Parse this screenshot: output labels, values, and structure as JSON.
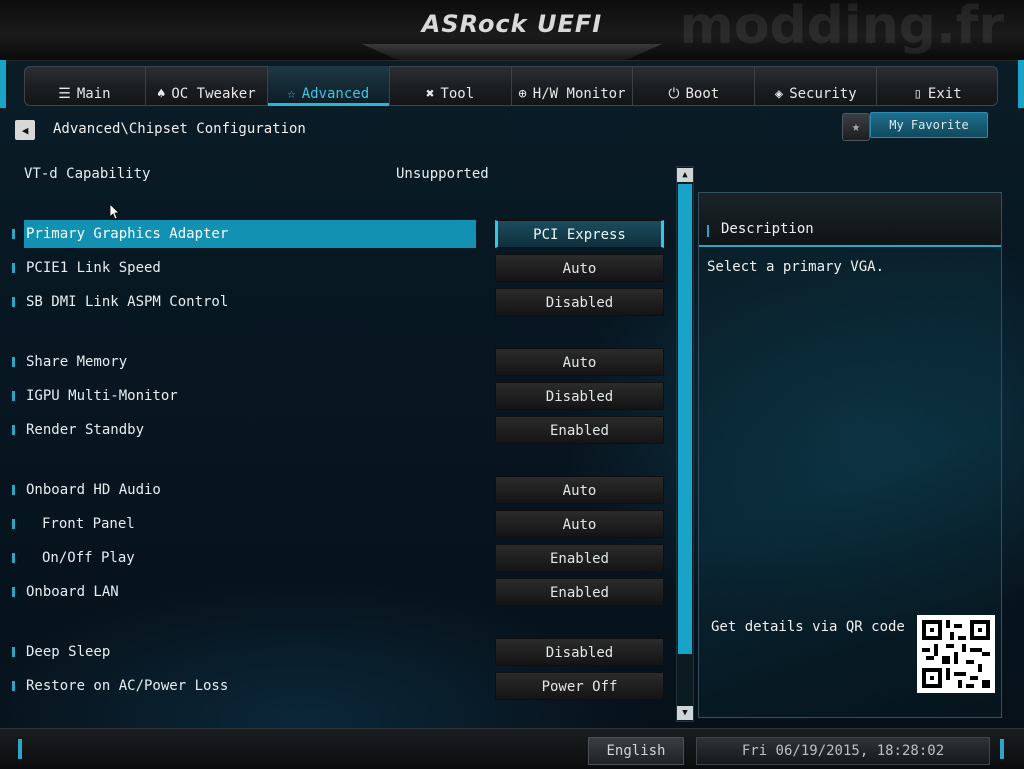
{
  "header": {
    "logo": "ASRock UEFI",
    "watermark": "modding.fr"
  },
  "tabs": [
    {
      "label": "Main",
      "icon": "list-icon",
      "glyph": "☰",
      "active": false
    },
    {
      "label": "OC Tweaker",
      "icon": "rocket-icon",
      "glyph": "♠",
      "active": false
    },
    {
      "label": "Advanced",
      "icon": "star-icon",
      "glyph": "☆",
      "active": true
    },
    {
      "label": "Tool",
      "icon": "tools-icon",
      "glyph": "✖",
      "active": false
    },
    {
      "label": "H/W Monitor",
      "icon": "monitor-icon",
      "glyph": "⊕",
      "active": false
    },
    {
      "label": "Boot",
      "icon": "power-icon",
      "glyph": "⏻",
      "active": false
    },
    {
      "label": "Security",
      "icon": "shield-icon",
      "glyph": "◈",
      "active": false
    },
    {
      "label": "Exit",
      "icon": "exit-door-icon",
      "glyph": "▯",
      "active": false
    }
  ],
  "breadcrumb": "Advanced\\Chipset Configuration",
  "favorite": {
    "label": "My Favorite"
  },
  "static_item": {
    "label": "VT-d Capability",
    "value": "Unsupported"
  },
  "settings": [
    {
      "label": "Primary Graphics Adapter",
      "value": "PCI Express",
      "selected": true,
      "indent": false
    },
    {
      "label": "PCIE1 Link Speed",
      "value": "Auto",
      "selected": false,
      "indent": false
    },
    {
      "label": "SB DMI Link ASPM Control",
      "value": "Disabled",
      "selected": false,
      "indent": false
    },
    {
      "label": "Share Memory",
      "value": "Auto",
      "selected": false,
      "indent": false
    },
    {
      "label": "IGPU Multi-Monitor",
      "value": "Disabled",
      "selected": false,
      "indent": false
    },
    {
      "label": "Render Standby",
      "value": "Enabled",
      "selected": false,
      "indent": false
    },
    {
      "label": "Onboard HD Audio",
      "value": "Auto",
      "selected": false,
      "indent": false
    },
    {
      "label": "Front Panel",
      "value": "Auto",
      "selected": false,
      "indent": true
    },
    {
      "label": "On/Off Play",
      "value": "Enabled",
      "selected": false,
      "indent": true
    },
    {
      "label": "Onboard LAN",
      "value": "Enabled",
      "selected": false,
      "indent": false
    },
    {
      "label": "Deep Sleep",
      "value": "Disabled",
      "selected": false,
      "indent": false
    },
    {
      "label": "Restore on AC/Power Loss",
      "value": "Power Off",
      "selected": false,
      "indent": false
    }
  ],
  "description": {
    "title": "Description",
    "text": "Select a primary VGA.",
    "qr_text": "Get details via QR code"
  },
  "footer": {
    "language": "English",
    "datetime": "Fri 06/19/2015, 18:28:02"
  },
  "colors": {
    "accent": "#1aa3c8",
    "selected_row": "#1391b3",
    "active_tab_text": "#39c6e6"
  }
}
